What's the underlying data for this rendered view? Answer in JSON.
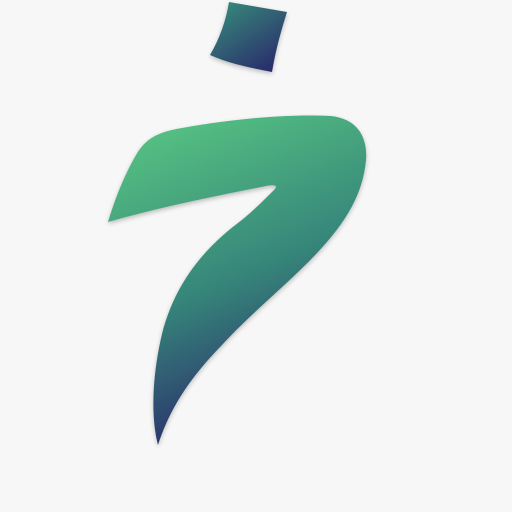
{
  "logo": {
    "icon": "stylized-arabic-letter-kha-icon",
    "gradient_colors": {
      "light_green": "#56c282",
      "teal": "#36867a",
      "navy": "#2a2d6b"
    },
    "background": "#f7f7f7"
  }
}
